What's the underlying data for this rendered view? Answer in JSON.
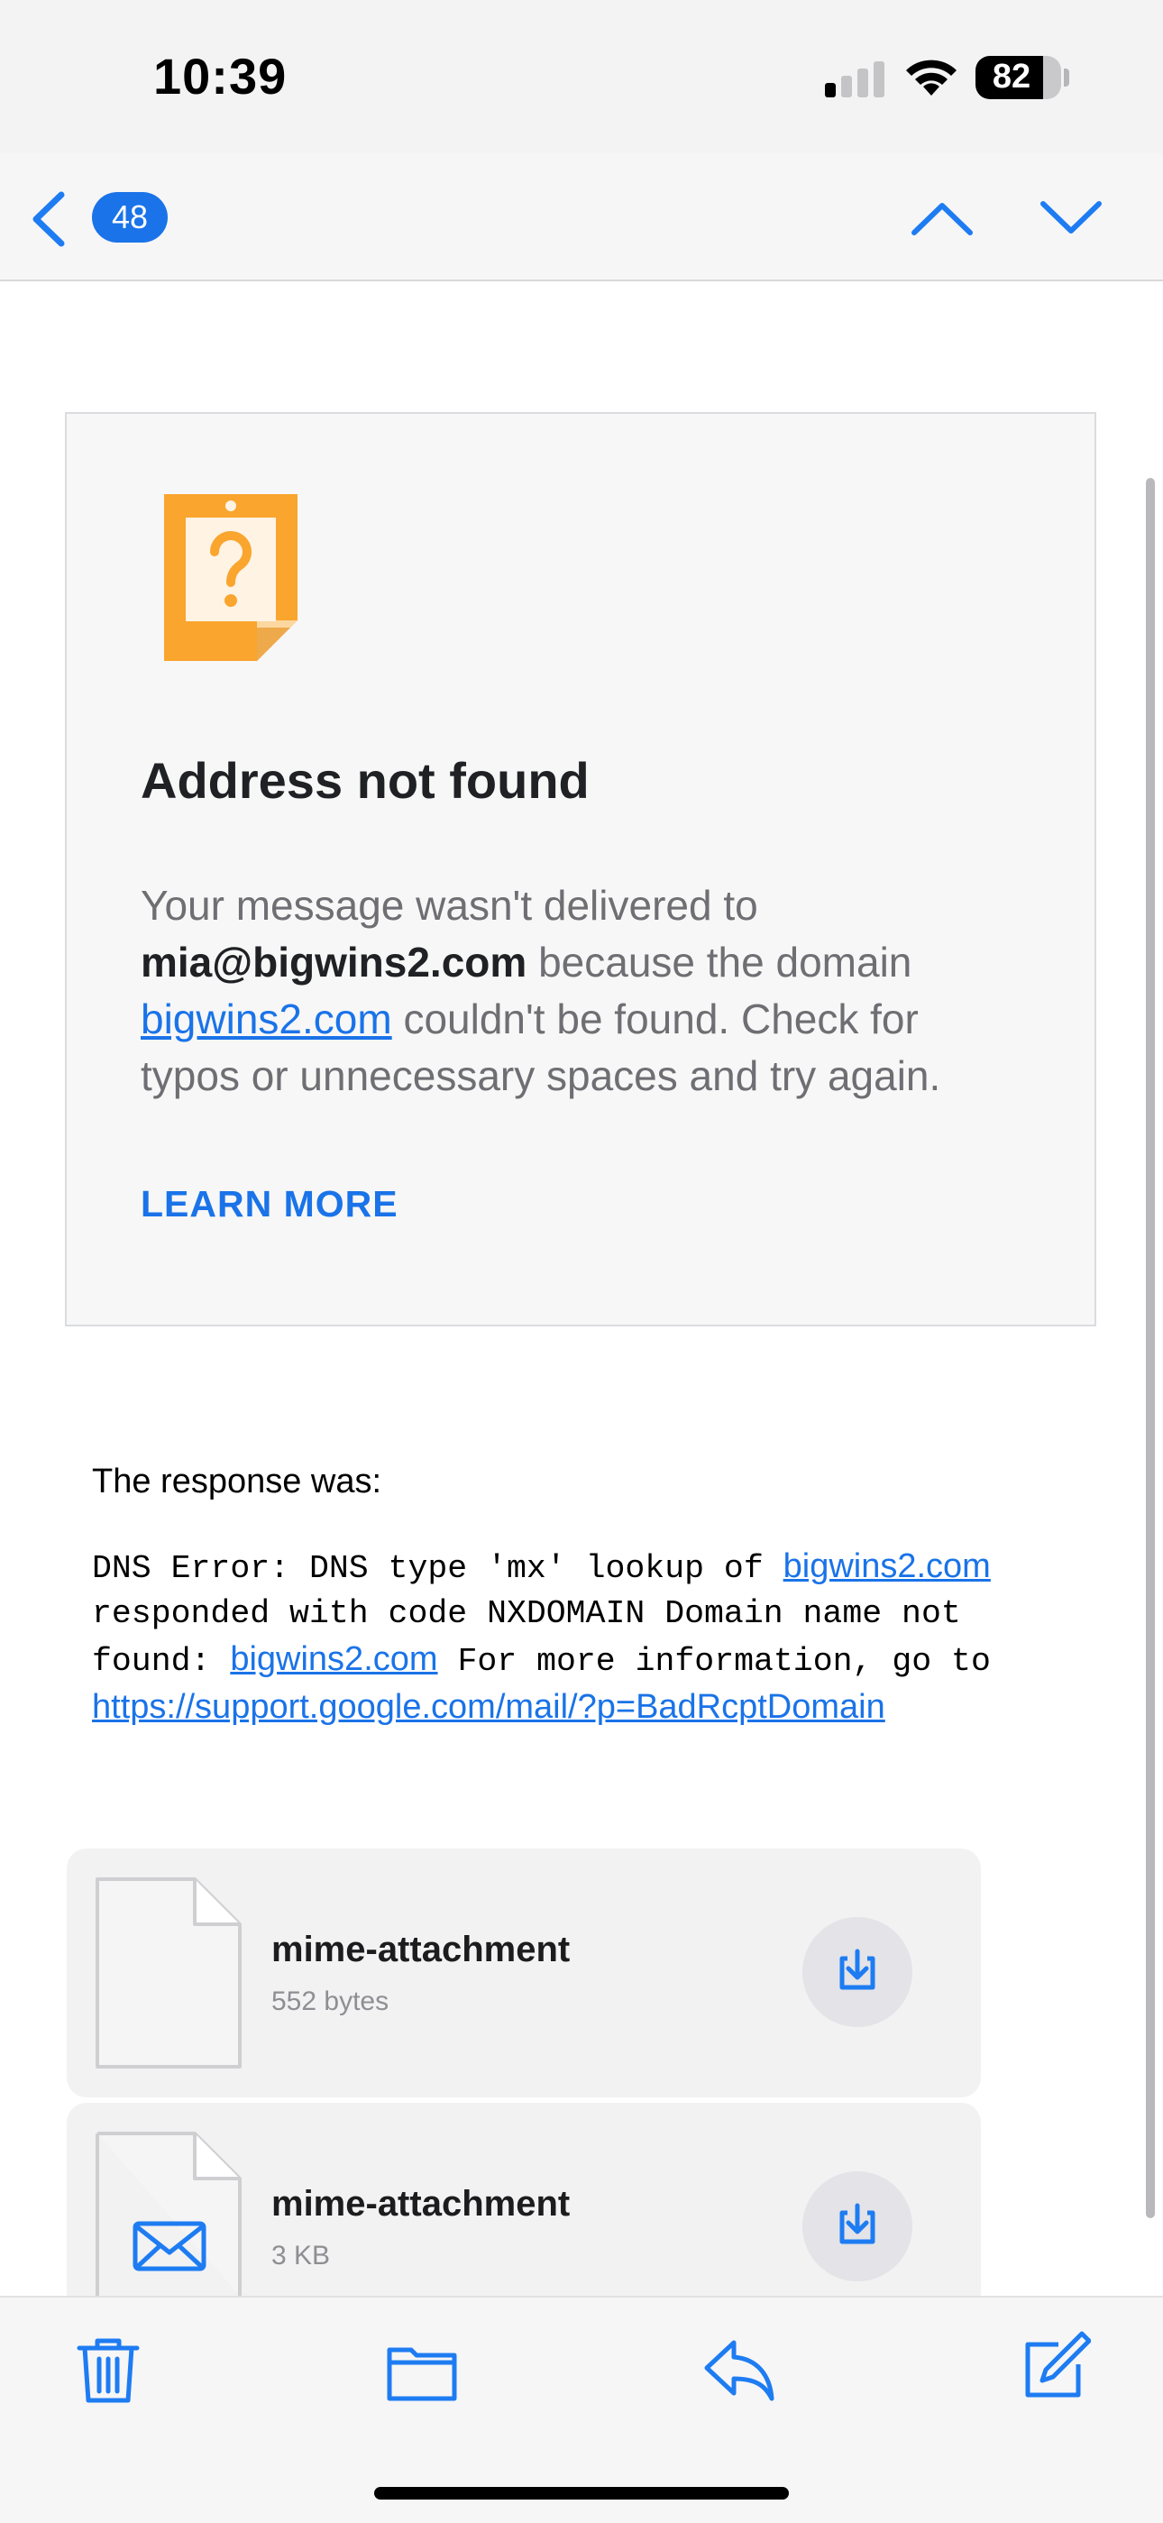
{
  "status_bar": {
    "time": "10:39",
    "battery": "82",
    "battery_level_percent": 82,
    "icons": [
      "signal-icon",
      "wifi-icon",
      "battery-icon"
    ]
  },
  "nav": {
    "back_icon": "chevron-left-icon",
    "message_count": "48",
    "prev_icon": "chevron-up-icon",
    "next_icon": "chevron-down-icon"
  },
  "card": {
    "icon": "question-document-icon",
    "title": "Address not found",
    "body_part1": "Your message wasn't delivered to ",
    "recipient": "mia@bigwins2.com",
    "body_part2": " because the domain ",
    "domain_link": "bigwins2.com",
    "body_part3": " couldn't be found. Check for typos or unnecessary spaces and try again.",
    "learn_more": "LEARN MORE"
  },
  "response": {
    "label": "The response was:",
    "line1_text": "DNS Error: DNS type 'mx' lookup of ",
    "line1_link": "bigwins2.com",
    "line2_text": "responded with code NXDOMAIN Domain name not",
    "line3_text_before": "found: ",
    "line3_link": "bigwins2.com",
    "line3_text_after": " For more information, go to",
    "url": "https://support.google.com/mail/?p=BadRcptDomain"
  },
  "attachments": [
    {
      "name": "mime-attachment",
      "size": "552 bytes",
      "icon": "blank-file-icon"
    },
    {
      "name": "mime-attachment",
      "size": "3 KB",
      "icon": "envelope-file-icon"
    }
  ],
  "toolbar": {
    "icons": [
      "trash-icon",
      "folder-icon",
      "reply-icon",
      "compose-icon"
    ]
  },
  "colors": {
    "accent": "#1a73e8",
    "ios_blue": "#1e7cf2",
    "warning_orange": "#f9a52e"
  }
}
